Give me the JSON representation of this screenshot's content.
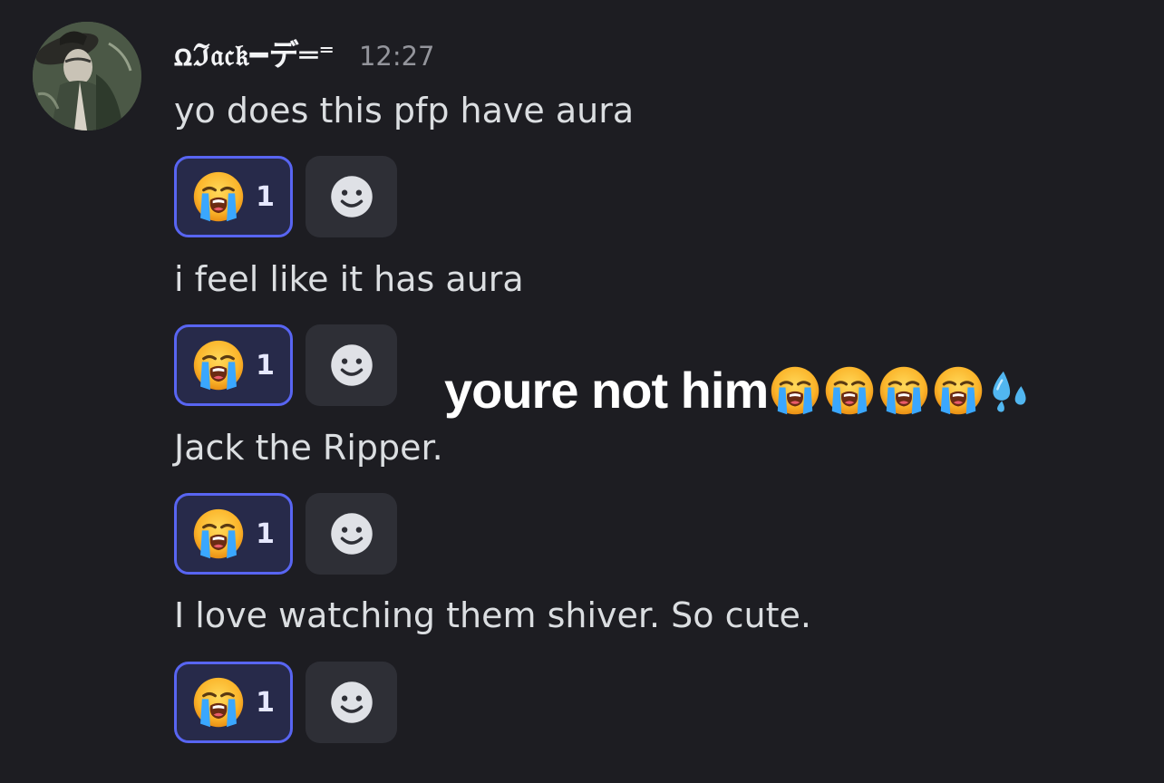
{
  "message": {
    "author": "ꭥℑ𝔞𝔠𝔨━デ═⁼",
    "timestamp": "12:27",
    "lines": [
      {
        "text": "yo does this pfp have aura",
        "reaction": {
          "emoji": "loudly-crying-face",
          "count": "1"
        }
      },
      {
        "text": "i feel like it has aura",
        "reaction": {
          "emoji": "loudly-crying-face",
          "count": "1"
        }
      },
      {
        "text": "Jack the Ripper.",
        "reaction": {
          "emoji": "loudly-crying-face",
          "count": "1"
        }
      },
      {
        "text": "I love watching them shiver. So cute.",
        "reaction": {
          "emoji": "loudly-crying-face",
          "count": "1"
        }
      }
    ]
  },
  "overlay": {
    "caption": "youre not him",
    "emojis": [
      "loudly-crying-face",
      "loudly-crying-face",
      "loudly-crying-face",
      "loudly-crying-face",
      "sweat-droplets"
    ]
  },
  "colors": {
    "background": "#1d1d22",
    "reaction_border": "#5865f2",
    "reaction_bg": "#272a4a",
    "add_reaction_bg": "#2e2f36"
  }
}
